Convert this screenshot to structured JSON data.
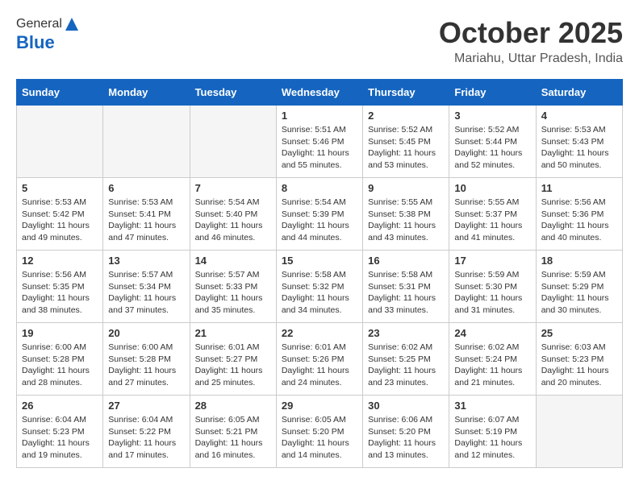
{
  "logo": {
    "general": "General",
    "blue": "Blue"
  },
  "header": {
    "month": "October 2025",
    "location": "Mariahu, Uttar Pradesh, India"
  },
  "weekdays": [
    "Sunday",
    "Monday",
    "Tuesday",
    "Wednesday",
    "Thursday",
    "Friday",
    "Saturday"
  ],
  "weeks": [
    [
      {
        "day": "",
        "info": ""
      },
      {
        "day": "",
        "info": ""
      },
      {
        "day": "",
        "info": ""
      },
      {
        "day": "1",
        "info": "Sunrise: 5:51 AM\nSunset: 5:46 PM\nDaylight: 11 hours\nand 55 minutes."
      },
      {
        "day": "2",
        "info": "Sunrise: 5:52 AM\nSunset: 5:45 PM\nDaylight: 11 hours\nand 53 minutes."
      },
      {
        "day": "3",
        "info": "Sunrise: 5:52 AM\nSunset: 5:44 PM\nDaylight: 11 hours\nand 52 minutes."
      },
      {
        "day": "4",
        "info": "Sunrise: 5:53 AM\nSunset: 5:43 PM\nDaylight: 11 hours\nand 50 minutes."
      }
    ],
    [
      {
        "day": "5",
        "info": "Sunrise: 5:53 AM\nSunset: 5:42 PM\nDaylight: 11 hours\nand 49 minutes."
      },
      {
        "day": "6",
        "info": "Sunrise: 5:53 AM\nSunset: 5:41 PM\nDaylight: 11 hours\nand 47 minutes."
      },
      {
        "day": "7",
        "info": "Sunrise: 5:54 AM\nSunset: 5:40 PM\nDaylight: 11 hours\nand 46 minutes."
      },
      {
        "day": "8",
        "info": "Sunrise: 5:54 AM\nSunset: 5:39 PM\nDaylight: 11 hours\nand 44 minutes."
      },
      {
        "day": "9",
        "info": "Sunrise: 5:55 AM\nSunset: 5:38 PM\nDaylight: 11 hours\nand 43 minutes."
      },
      {
        "day": "10",
        "info": "Sunrise: 5:55 AM\nSunset: 5:37 PM\nDaylight: 11 hours\nand 41 minutes."
      },
      {
        "day": "11",
        "info": "Sunrise: 5:56 AM\nSunset: 5:36 PM\nDaylight: 11 hours\nand 40 minutes."
      }
    ],
    [
      {
        "day": "12",
        "info": "Sunrise: 5:56 AM\nSunset: 5:35 PM\nDaylight: 11 hours\nand 38 minutes."
      },
      {
        "day": "13",
        "info": "Sunrise: 5:57 AM\nSunset: 5:34 PM\nDaylight: 11 hours\nand 37 minutes."
      },
      {
        "day": "14",
        "info": "Sunrise: 5:57 AM\nSunset: 5:33 PM\nDaylight: 11 hours\nand 35 minutes."
      },
      {
        "day": "15",
        "info": "Sunrise: 5:58 AM\nSunset: 5:32 PM\nDaylight: 11 hours\nand 34 minutes."
      },
      {
        "day": "16",
        "info": "Sunrise: 5:58 AM\nSunset: 5:31 PM\nDaylight: 11 hours\nand 33 minutes."
      },
      {
        "day": "17",
        "info": "Sunrise: 5:59 AM\nSunset: 5:30 PM\nDaylight: 11 hours\nand 31 minutes."
      },
      {
        "day": "18",
        "info": "Sunrise: 5:59 AM\nSunset: 5:29 PM\nDaylight: 11 hours\nand 30 minutes."
      }
    ],
    [
      {
        "day": "19",
        "info": "Sunrise: 6:00 AM\nSunset: 5:28 PM\nDaylight: 11 hours\nand 28 minutes."
      },
      {
        "day": "20",
        "info": "Sunrise: 6:00 AM\nSunset: 5:28 PM\nDaylight: 11 hours\nand 27 minutes."
      },
      {
        "day": "21",
        "info": "Sunrise: 6:01 AM\nSunset: 5:27 PM\nDaylight: 11 hours\nand 25 minutes."
      },
      {
        "day": "22",
        "info": "Sunrise: 6:01 AM\nSunset: 5:26 PM\nDaylight: 11 hours\nand 24 minutes."
      },
      {
        "day": "23",
        "info": "Sunrise: 6:02 AM\nSunset: 5:25 PM\nDaylight: 11 hours\nand 23 minutes."
      },
      {
        "day": "24",
        "info": "Sunrise: 6:02 AM\nSunset: 5:24 PM\nDaylight: 11 hours\nand 21 minutes."
      },
      {
        "day": "25",
        "info": "Sunrise: 6:03 AM\nSunset: 5:23 PM\nDaylight: 11 hours\nand 20 minutes."
      }
    ],
    [
      {
        "day": "26",
        "info": "Sunrise: 6:04 AM\nSunset: 5:23 PM\nDaylight: 11 hours\nand 19 minutes."
      },
      {
        "day": "27",
        "info": "Sunrise: 6:04 AM\nSunset: 5:22 PM\nDaylight: 11 hours\nand 17 minutes."
      },
      {
        "day": "28",
        "info": "Sunrise: 6:05 AM\nSunset: 5:21 PM\nDaylight: 11 hours\nand 16 minutes."
      },
      {
        "day": "29",
        "info": "Sunrise: 6:05 AM\nSunset: 5:20 PM\nDaylight: 11 hours\nand 14 minutes."
      },
      {
        "day": "30",
        "info": "Sunrise: 6:06 AM\nSunset: 5:20 PM\nDaylight: 11 hours\nand 13 minutes."
      },
      {
        "day": "31",
        "info": "Sunrise: 6:07 AM\nSunset: 5:19 PM\nDaylight: 11 hours\nand 12 minutes."
      },
      {
        "day": "",
        "info": ""
      }
    ]
  ]
}
